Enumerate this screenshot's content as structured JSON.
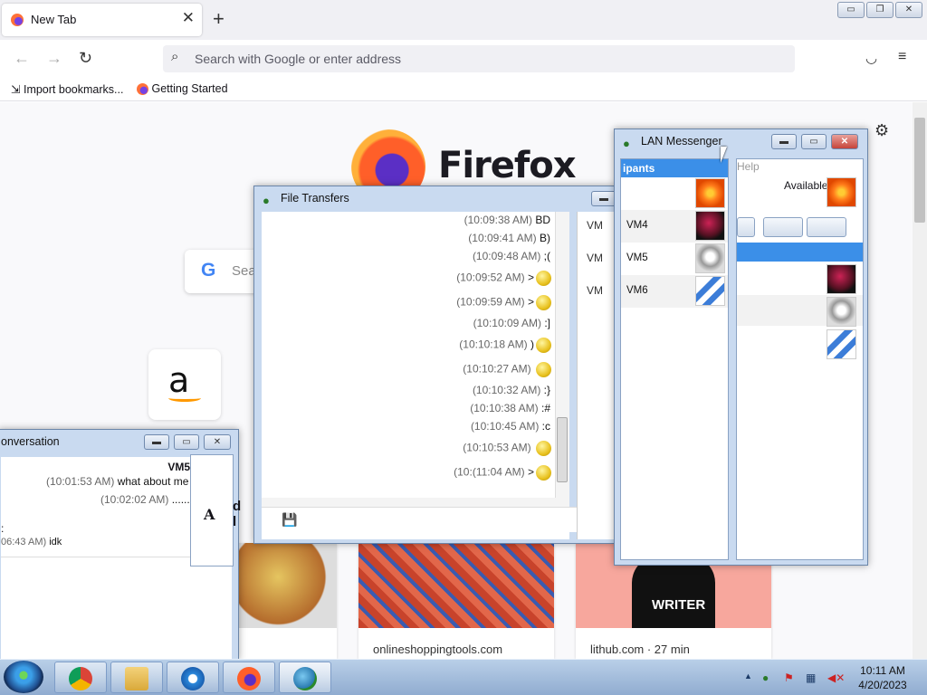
{
  "browser": {
    "tab_title": "New Tab",
    "close_tab": "✕",
    "new_tab": "+",
    "url_placeholder": "Search with Google or enter address",
    "bookmarks": [
      "Import bookmarks...",
      "Getting Started"
    ],
    "win_min": "▭",
    "win_max": "❐",
    "win_close": "✕"
  },
  "newtab": {
    "brand": "Firefox",
    "search_placeholder": "Sea",
    "shortcut_glyph": "a",
    "cards": [
      {
        "label": ""
      },
      {
        "label": "onlineshoppingtools.com"
      },
      {
        "label": "lithub.com · 27 min"
      }
    ],
    "shirt_text": "WRITER"
  },
  "conversation": {
    "title": "onversation",
    "sender": "VM5",
    "lines": [
      {
        "time": "(10:01:53 AM)",
        "text": "what about me"
      },
      {
        "time": "(10:02:02 AM)",
        "text": "......."
      },
      {
        "time": "06:43 AM)",
        "text": "idk"
      }
    ],
    "colon": ":",
    "toolbar_font": "A",
    "partial": "d l"
  },
  "file_transfers": {
    "title": "File Transfers",
    "messages": [
      {
        "time": "(10:09:38 AM)",
        "text": "BD"
      },
      {
        "time": "(10:09:41 AM)",
        "text": "B)"
      },
      {
        "time": "(10:09:48 AM)",
        "text": ";("
      },
      {
        "time": "(10:09:52 AM)",
        "text": ">"
      },
      {
        "time": "(10:09:59 AM)",
        "text": ">"
      },
      {
        "time": "(10:10:09 AM)",
        "text": ":]"
      },
      {
        "time": "(10:10:18 AM)",
        "text": ")"
      },
      {
        "time": "(10:10:27 AM)",
        "text": ""
      },
      {
        "time": "(10:10:32 AM)",
        "text": ":}"
      },
      {
        "time": "(10:10:38 AM)",
        "text": ":#"
      },
      {
        "time": "(10:10:45 AM)",
        "text": ":c"
      },
      {
        "time": "(10:10:53 AM)",
        "text": ""
      },
      {
        "time": "(11:04 AM)",
        "text": ">"
      }
    ],
    "time_prefix": "(10:",
    "side_labels": [
      "VM",
      "VM",
      "VM"
    ]
  },
  "lan": {
    "title": "LAN Messenger",
    "menu_help": "Help",
    "participants_header": "ipants",
    "status": "Available",
    "participants": [
      {
        "name": "",
        "avatar": "orange-flower"
      },
      {
        "name": "VM4",
        "avatar": "ball"
      },
      {
        "name": "VM5",
        "avatar": "robot"
      },
      {
        "name": "VM6",
        "avatar": "rollercoaster"
      }
    ]
  },
  "taskbar": {
    "time": "10:11 AM",
    "date": "4/20/2023",
    "tray_up": "▲"
  }
}
